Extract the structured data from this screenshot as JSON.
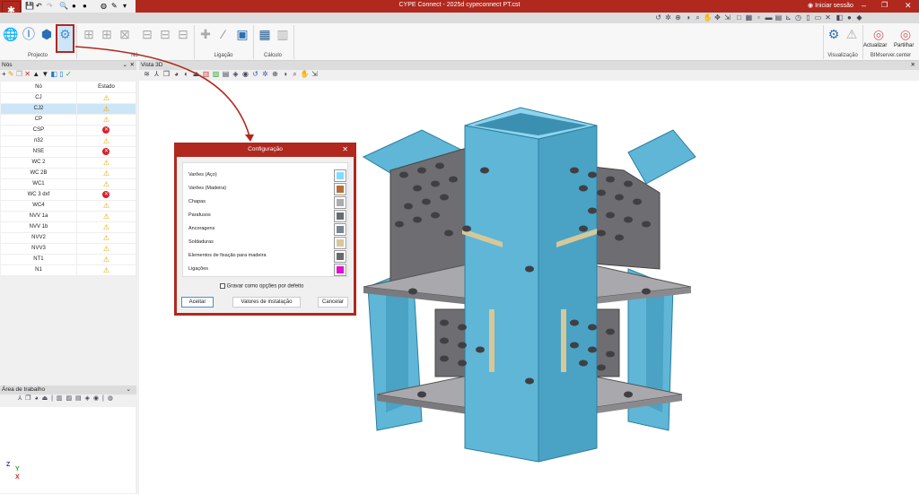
{
  "app": {
    "title": "CYPE Connect - 2025d cypeconnect PT.cst",
    "login": "Iniciar sessão"
  },
  "ribbon": {
    "groups": [
      "Projecto",
      "Nó",
      "Ligação",
      "Cálculo",
      "Visualização",
      "BIMserver.center"
    ],
    "actualizar": "Actualizar",
    "partilhar": "Partilhar"
  },
  "nodes_panel": {
    "title": "Nós",
    "col_node": "Nó",
    "col_state": "Estado",
    "rows": [
      {
        "name": "CJ",
        "state": "warning"
      },
      {
        "name": "CJ2",
        "state": "warning"
      },
      {
        "name": "CP",
        "state": "warning"
      },
      {
        "name": "CSP",
        "state": "error"
      },
      {
        "name": "n32",
        "state": "warning"
      },
      {
        "name": "NSE",
        "state": "error"
      },
      {
        "name": "WC 2",
        "state": "warning"
      },
      {
        "name": "WC 2B",
        "state": "warning"
      },
      {
        "name": "WC1",
        "state": "warning"
      },
      {
        "name": "WC 3 dxf",
        "state": "error"
      },
      {
        "name": "WC4",
        "state": "warning"
      },
      {
        "name": "NVV 1a",
        "state": "warning"
      },
      {
        "name": "NVV 1b",
        "state": "warning"
      },
      {
        "name": "NVV2",
        "state": "warning"
      },
      {
        "name": "NVV3",
        "state": "warning"
      },
      {
        "name": "NT1",
        "state": "warning"
      },
      {
        "name": "N1",
        "state": "warning"
      }
    ]
  },
  "work_panel": {
    "title": "Área de trabalho"
  },
  "view": {
    "title": "Vista 3D"
  },
  "dialog": {
    "title": "Configuração",
    "items": [
      {
        "label": "Varões (Aço)",
        "color": "#7fdcff"
      },
      {
        "label": "Varões (Madeira)",
        "color": "#b26f3a"
      },
      {
        "label": "Chapas",
        "color": "#acacac"
      },
      {
        "label": "Parafusos",
        "color": "#676b72"
      },
      {
        "label": "Ancoragens",
        "color": "#7a8390"
      },
      {
        "label": "Soldaduras",
        "color": "#d6c89a"
      },
      {
        "label": "Elementos de fixação para madeira",
        "color": "#656970"
      },
      {
        "label": "Ligações",
        "color": "#e010d0"
      }
    ],
    "checkbox": "Gravar como opções por defeito",
    "accept": "Aceitar",
    "defaults": "Valores de instalação",
    "cancel": "Cancelar"
  },
  "axes": {
    "z": "Z",
    "y": "Y",
    "x": "X"
  }
}
